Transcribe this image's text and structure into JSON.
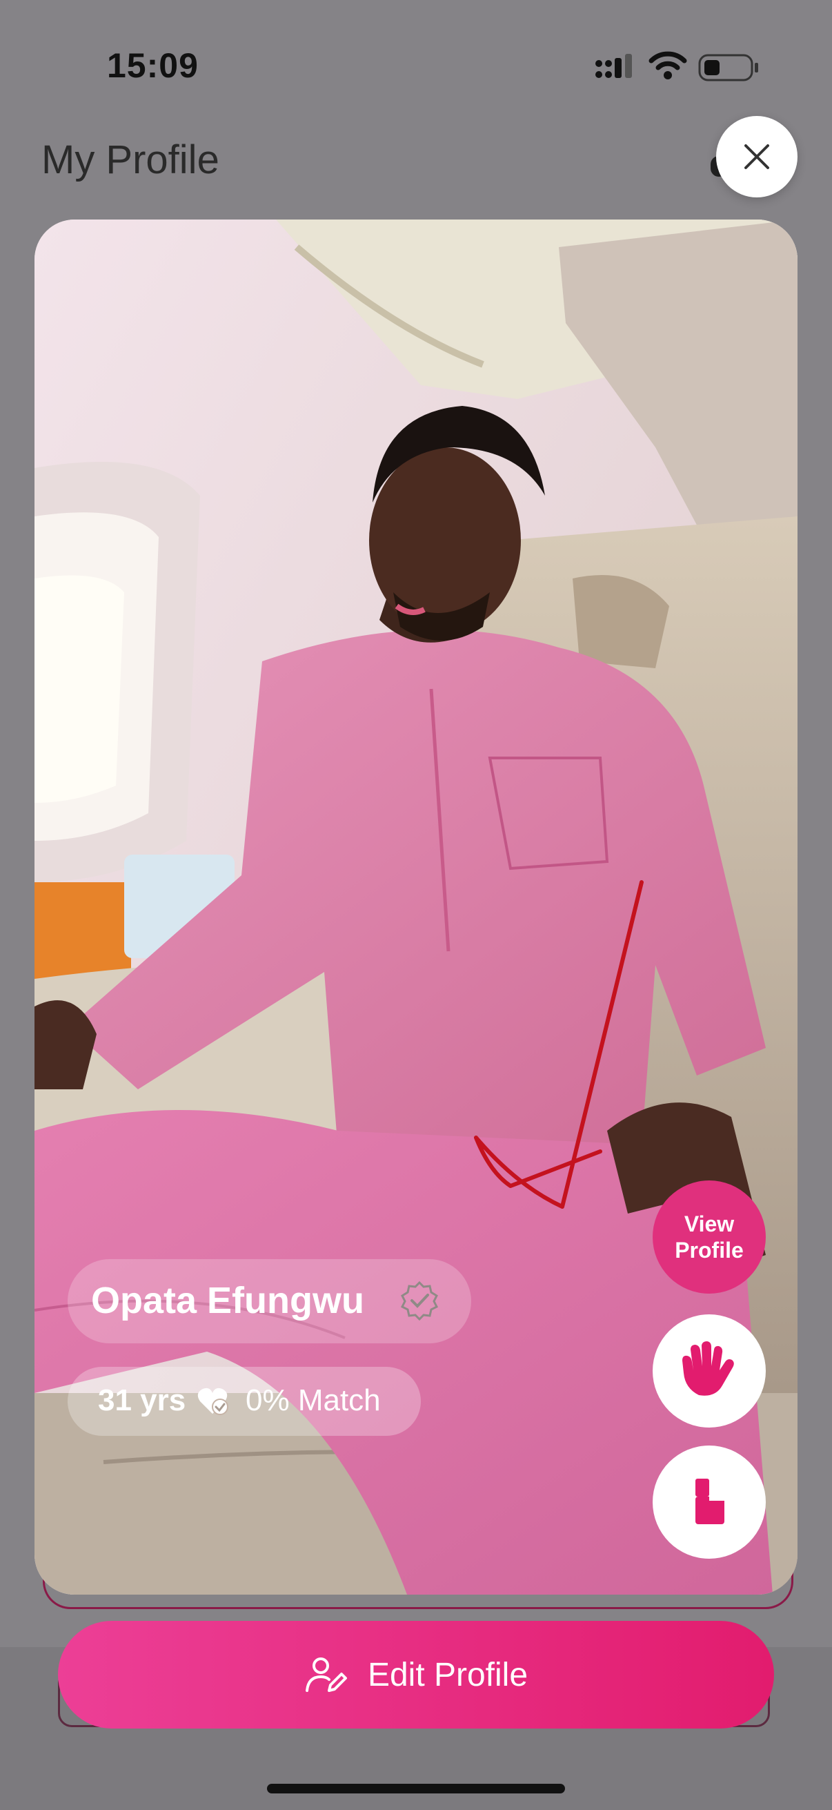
{
  "status_bar": {
    "time": "15:09"
  },
  "header": {
    "title": "My Profile"
  },
  "profile": {
    "name": "Opata Efungwu",
    "age": "31 yrs",
    "match": "0% Match"
  },
  "actions": {
    "view_profile_line1": "View",
    "view_profile_line2": "Profile",
    "edit_profile": "Edit Profile"
  },
  "icons": {
    "close": "close-icon",
    "verified": "verified-badge-icon",
    "heart_check": "heart-check-icon",
    "wave": "waving-hand-icon",
    "block": "block-icon",
    "edit": "user-edit-icon"
  },
  "colors": {
    "accent": "#e0307d",
    "gradient_start": "#ec3f96",
    "gradient_end": "#e21c6e",
    "background": "#858387"
  }
}
